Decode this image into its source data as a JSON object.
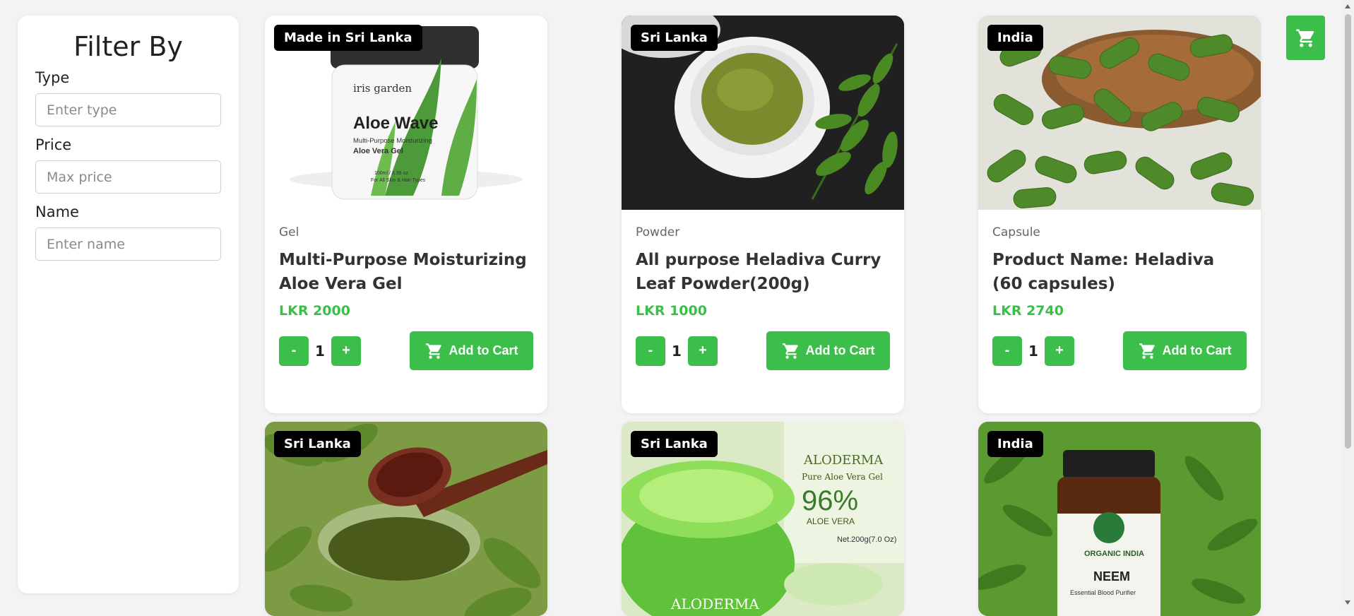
{
  "filter": {
    "title": "Filter By",
    "type_label": "Type",
    "type_placeholder": "Enter type",
    "price_label": "Price",
    "price_placeholder": "Max price",
    "name_label": "Name",
    "name_placeholder": "Enter name"
  },
  "colors": {
    "accent": "#3bbf4a",
    "badge": "#000000",
    "page_bg": "#f3f3f3"
  },
  "products": [
    {
      "badge": "Made in Sri Lanka",
      "type": "Gel",
      "name": "Multi-Purpose Moisturizing Aloe Vera Gel",
      "price": "LKR 2000",
      "qty": "1",
      "add_label": "Add to Cart",
      "minus": "-",
      "plus": "+"
    },
    {
      "badge": "Sri Lanka",
      "type": "Powder",
      "name": "All purpose Heladiva Curry Leaf Powder(200g)",
      "price": "LKR 1000",
      "qty": "1",
      "add_label": "Add to Cart",
      "minus": "-",
      "plus": "+"
    },
    {
      "badge": "India",
      "type": "Capsule",
      "name": "Product Name: Heladiva (60 capsules)",
      "price": "LKR 2740",
      "qty": "1",
      "add_label": "Add to Cart",
      "minus": "-",
      "plus": "+"
    },
    {
      "badge": "Sri Lanka"
    },
    {
      "badge": "Sri Lanka"
    },
    {
      "badge": "India"
    }
  ],
  "product_images": {
    "p0": {
      "jar_brand": "iris garden",
      "jar_title": "Aloe Wave",
      "jar_sub1": "Multi-Purpose Moisturizing",
      "jar_sub2": "Aloe Vera Gel",
      "jar_size": "100ml / 3.38 oz",
      "jar_note": "For All Skin & Hair Types"
    },
    "p4": {
      "brand": "ALODERMA",
      "sub": "Pure Aloe Vera Gel",
      "pct": "96%",
      "pct_sub": "ALOE VERA",
      "net": "Net.200g(7.0 Oz)",
      "jar_brand": "ALODERMA"
    },
    "p5": {
      "brand": "ORGANIC INDIA",
      "title": "NEEM",
      "sub": "Essential Blood Purifier"
    }
  },
  "icons": {
    "cart": "shopping-cart-icon"
  }
}
